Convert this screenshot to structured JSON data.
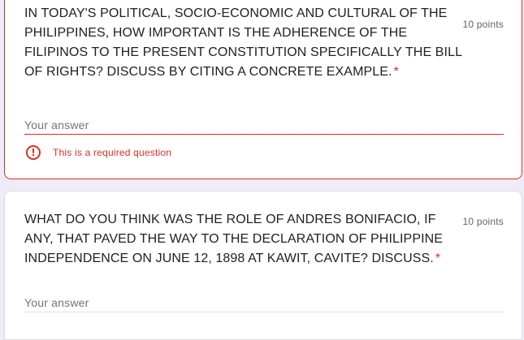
{
  "questions": [
    {
      "text": "IN TODAY'S POLITICAL, SOCIO-ECONOMIC AND CULTURAL OF THE PHILIPPINES, HOW IMPORTANT IS THE ADHERENCE OF THE FILIPINOS TO THE PRESENT CONSTITUTION SPECIFICALLY THE BILL OF RIGHTS? DISCUSS BY CITING A CONCRETE EXAMPLE.",
      "required_marker": "*",
      "points": "10 points",
      "answer_placeholder": "Your answer",
      "error_message": "This is a required question",
      "error_icon": "exclamation-circle-icon"
    },
    {
      "text": "WHAT DO YOU THINK WAS THE ROLE OF ANDRES BONIFACIO, IF ANY, THAT PAVED THE WAY TO THE DECLARATION OF PHILIPPINE INDEPENDENCE ON JUNE 12, 1898 AT KAWIT, CAVITE? DISCUSS.",
      "required_marker": "*",
      "points": "10 points",
      "answer_placeholder": "Your answer"
    }
  ],
  "colors": {
    "background": "#f0ebf8",
    "error": "#d93025",
    "text": "#202124",
    "muted": "#5f6368"
  }
}
